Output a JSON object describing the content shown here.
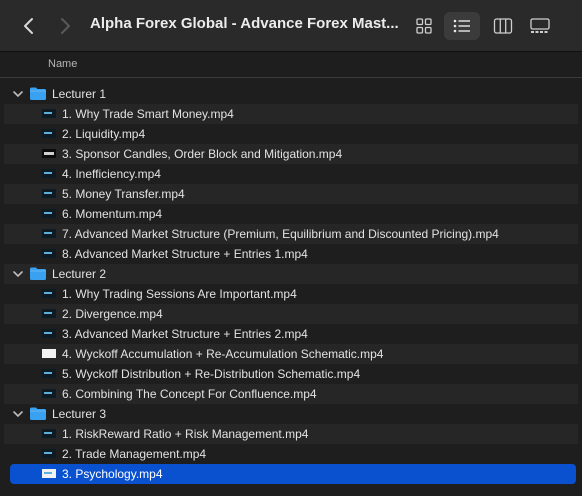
{
  "window": {
    "title": "Alpha Forex Global - Advance Forex Mast..."
  },
  "toolbar": {
    "back_icon": "chevron-left-icon",
    "forward_icon": "chevron-right-icon",
    "views": [
      "icon-view",
      "list-view",
      "column-view",
      "gallery-view"
    ],
    "active_view": "list-view"
  },
  "header": {
    "name": "Name"
  },
  "colors": {
    "accent": "#0a51d0",
    "folder": "#3aa0f0"
  },
  "tree": {
    "folders": [
      {
        "label": "Lecturer 1",
        "files": [
          "1. Why Trade Smart Money.mp4",
          "2. Liquidity.mp4",
          "3. Sponsor Candles, Order Block and Mitigation.mp4",
          "4. Inefficiency.mp4",
          "5. Money Transfer.mp4",
          "6. Momentum.mp4",
          "7. Advanced Market Structure (Premium, Equilibrium and Discounted Pricing).mp4",
          "8. Advanced Market Structure + Entries 1.mp4"
        ]
      },
      {
        "label": "Lecturer 2",
        "files": [
          "1. Why Trading Sessions Are Important.mp4",
          "2. Divergence.mp4",
          "3. Advanced Market Structure + Entries 2.mp4",
          "4. Wyckoff Accumulation + Re-Accumulation Schematic.mp4",
          "5. Wyckoff Distribution + Re-Distribution Schematic.mp4",
          "6. Combining The Concept For Confluence.mp4"
        ]
      },
      {
        "label": "Lecturer 3",
        "files": [
          "1. RiskReward Ratio + Risk Management.mp4",
          "2. Trade Management.mp4",
          "3. Psychology.mp4"
        ]
      }
    ],
    "selected": "3. Psychology.mp4"
  }
}
